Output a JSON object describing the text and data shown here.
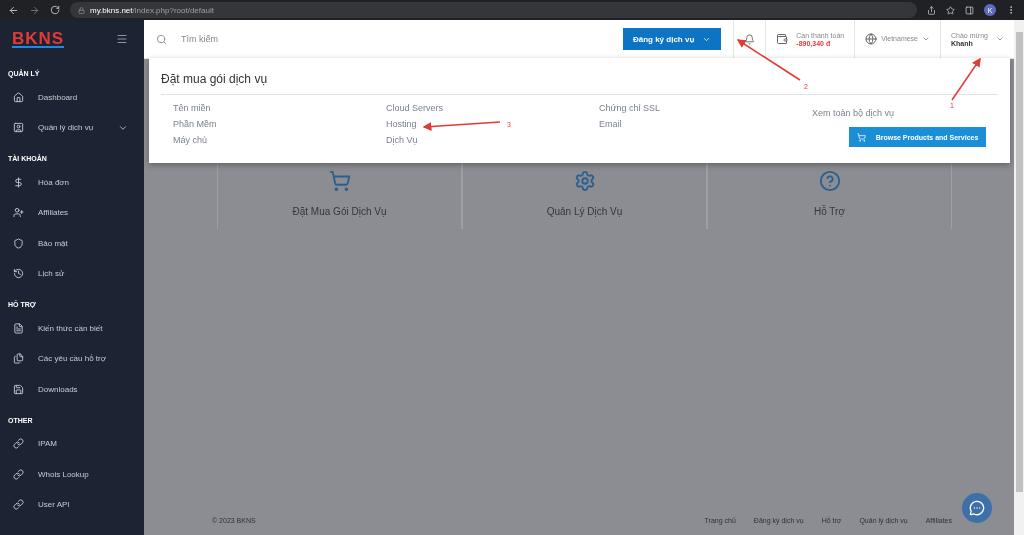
{
  "browser": {
    "url": "**my.bkns.net**/index.php?root/default",
    "avatar": "K"
  },
  "sidebar": {
    "logo": "BKNS",
    "sections": [
      {
        "title": "QUẢN LÝ",
        "items": [
          {
            "label": "Dashboard"
          },
          {
            "label": "Quản lý dịch vụ",
            "expanded": false
          }
        ]
      },
      {
        "title": "TÀI KHOẢN",
        "items": [
          {
            "label": "Hóa đơn"
          },
          {
            "label": "Affiliates"
          },
          {
            "label": "Bảo mật"
          },
          {
            "label": "Lịch sử"
          }
        ]
      },
      {
        "title": "HỖ TRỢ",
        "items": [
          {
            "label": "Kiến thức cần biết"
          },
          {
            "label": "Các yêu cầu hỗ trợ"
          },
          {
            "label": "Downloads"
          }
        ]
      },
      {
        "title": "OTHER",
        "items": [
          {
            "label": "IPAM"
          },
          {
            "label": "Whois Lookup"
          },
          {
            "label": "User API"
          }
        ]
      }
    ]
  },
  "topbar": {
    "search": {
      "placeholder": "Tìm kiếm"
    },
    "order_button": "Đăng ký dịch vụ",
    "balance": {
      "label": "Cần thanh toán",
      "amount": "-890,340 đ"
    },
    "language": "Vietnamese",
    "greeting": {
      "label": "Chào mừng",
      "name": "Khanh"
    }
  },
  "dropdown": {
    "title": "Đặt mua gói dịch vụ",
    "columns": [
      [
        "Tên miền",
        "Phần Mềm",
        "Máy chủ"
      ],
      [
        "Cloud Servers",
        "Hosting",
        "Dịch Vụ"
      ],
      [
        "Chứng chỉ SSL",
        "Email"
      ]
    ],
    "view_all": "Xem toàn bộ dịch vụ",
    "browse_button": "Browse Products and Services"
  },
  "cards": [
    {
      "label": "Đặt Mua Gói Dịch Vụ"
    },
    {
      "label": "Quản Lý Dịch Vụ"
    },
    {
      "label": "Hỗ Trợ"
    }
  ],
  "footer": {
    "copyright": "© 2023 BKNS",
    "links": [
      "Trang chủ",
      "Đăng ký dịch vụ",
      "Hỗ trợ",
      "Quản lý dịch vụ",
      "Affiliates"
    ]
  },
  "annotations": [
    {
      "label": "1"
    },
    {
      "label": "2"
    },
    {
      "label": "3"
    }
  ]
}
